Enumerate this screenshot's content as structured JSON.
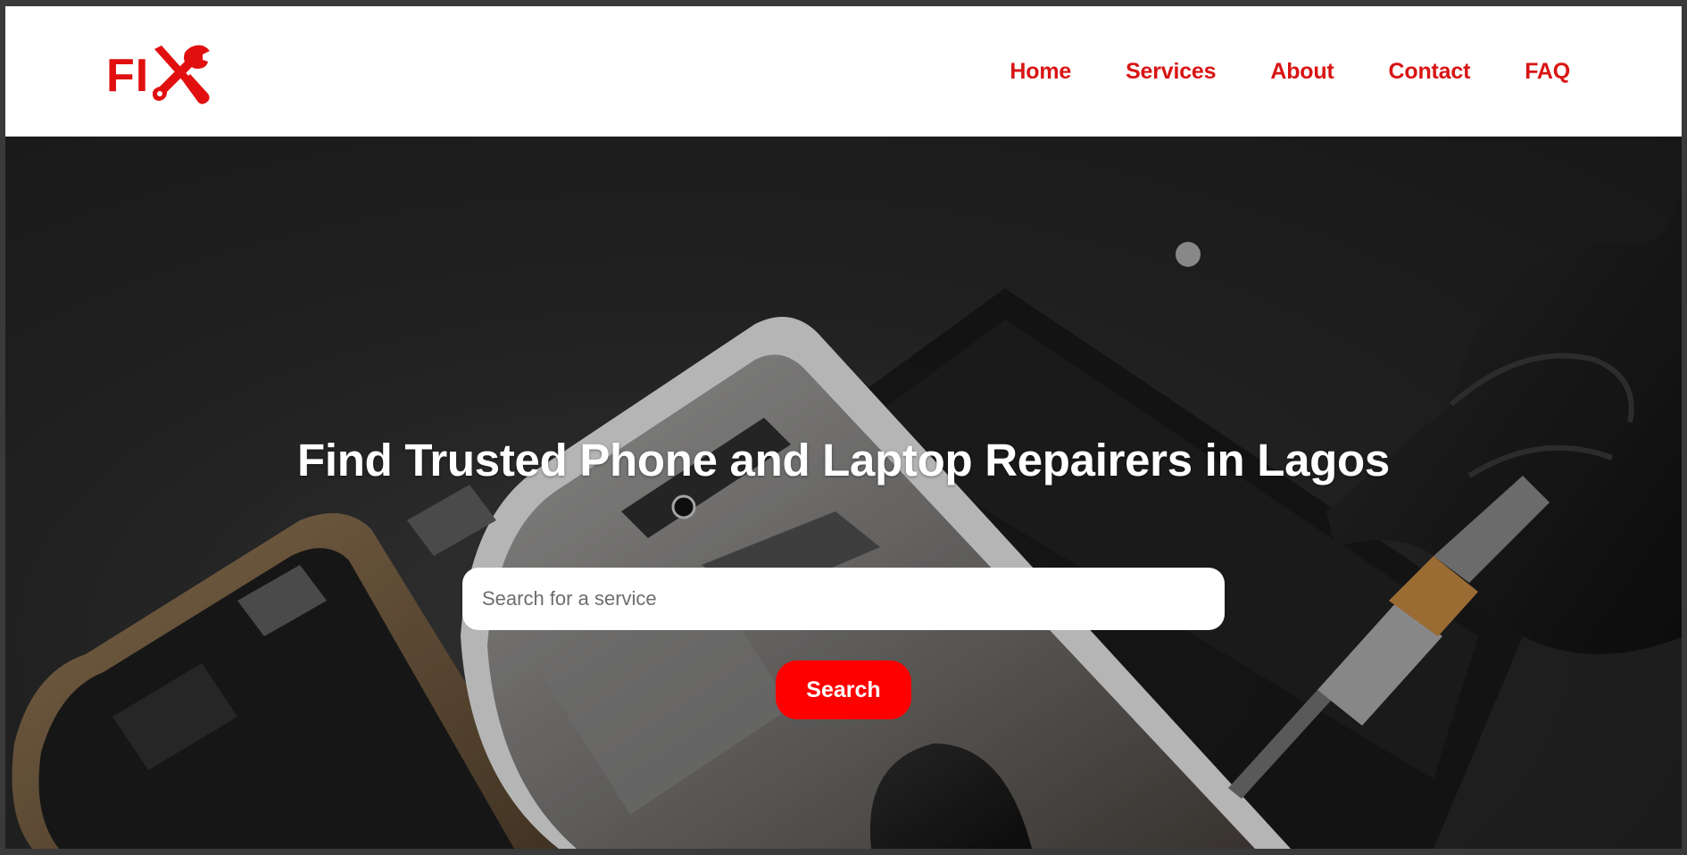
{
  "brand": {
    "logo_text": "FI",
    "logo_icon": "crossed-wrench-screwdriver-icon",
    "color": "#e10f0f"
  },
  "nav": {
    "items": [
      {
        "label": "Home"
      },
      {
        "label": "Services"
      },
      {
        "label": "About"
      },
      {
        "label": "Contact"
      },
      {
        "label": "FAQ"
      }
    ],
    "color": "#d91414"
  },
  "hero": {
    "title": "Find Trusted Phone and Laptop Repairers in Lagos",
    "background": "phone-repair-photo"
  },
  "search": {
    "placeholder": "Search for a service",
    "value": "",
    "button_label": "Search",
    "button_color": "#ff0000"
  }
}
